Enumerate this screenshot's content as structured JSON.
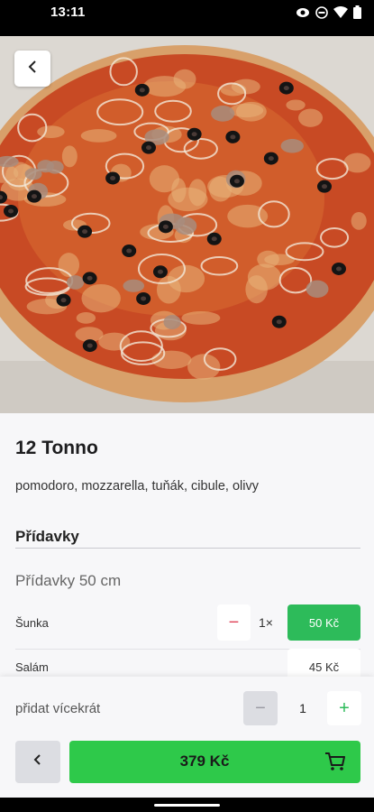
{
  "status_bar": {
    "time": "13:11",
    "icons": [
      "eye-icon",
      "do-not-disturb-icon",
      "wifi-icon",
      "battery-icon"
    ]
  },
  "product": {
    "image_icon": "pizza-photo",
    "name": "12 Tonno",
    "description": "pomodoro, mozzarella, tuňák, cibule, olivy"
  },
  "extras": {
    "section_title": "Přídavky",
    "group_title": "Přídavky 50 cm",
    "items": [
      {
        "name": "Šunka",
        "quantity_label": "1×",
        "price": "50 Kč",
        "selected": true
      },
      {
        "name": "Salám",
        "price": "45 Kč",
        "selected": false
      }
    ]
  },
  "footer": {
    "multi_label": "přidat vícekrát",
    "quantity": "1",
    "total": "379 Kč",
    "minus_symbol": "−",
    "plus_symbol": "+"
  },
  "colors": {
    "accent_green": "#2ec94a",
    "selected_green": "#2dbb5a",
    "minus_red": "#e0455a"
  }
}
